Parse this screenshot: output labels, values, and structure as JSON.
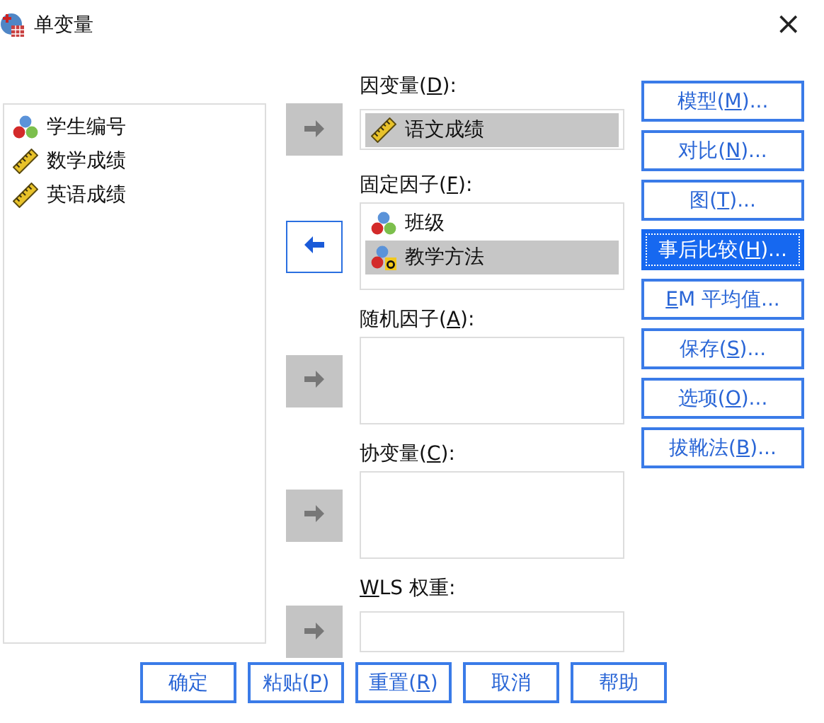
{
  "window": {
    "title": "单变量",
    "close": "×"
  },
  "variables": [
    {
      "name": "学生编号",
      "kind": "nominal"
    },
    {
      "name": "数学成绩",
      "kind": "scale"
    },
    {
      "name": "英语成绩",
      "kind": "scale"
    }
  ],
  "targets": [
    {
      "label": {
        "before": "因变量(",
        "key": "D",
        "after": "):"
      },
      "kind": "single",
      "arrow_disabled": true,
      "items": [
        {
          "name": "语文成绩",
          "kind": "scale",
          "selected": true
        }
      ]
    },
    {
      "label": {
        "before": "固定因子(",
        "key": "F",
        "after": "):"
      },
      "kind": "list",
      "arrow_disabled": false,
      "items": [
        {
          "name": "班级",
          "kind": "nominal",
          "selected": false
        },
        {
          "name": "教学方法",
          "kind": "nominal-string",
          "selected": true
        }
      ]
    },
    {
      "label": {
        "before": "随机因子(",
        "key": "A",
        "after": "):"
      },
      "kind": "list",
      "arrow_disabled": true
    },
    {
      "label": {
        "before": "协变量(",
        "key": "C",
        "after": "):"
      },
      "kind": "list",
      "arrow_disabled": true
    },
    {
      "label": {
        "key": "W",
        "after": "LS 权重:"
      },
      "kind": "single",
      "arrow_disabled": true
    }
  ],
  "side_buttons": [
    {
      "label": {
        "before": "模型(",
        "key": "M",
        "after": ")..."
      },
      "selected": false
    },
    {
      "label": {
        "before": "对比(",
        "key": "N",
        "after": ")..."
      },
      "selected": false
    },
    {
      "label": {
        "before": "图(",
        "key": "T",
        "after": ")..."
      },
      "selected": false
    },
    {
      "label": {
        "before": "事后比较(",
        "key": "H",
        "after": ")..."
      },
      "selected": true
    },
    {
      "label": {
        "key": "E",
        "after": "M 平均值..."
      },
      "selected": false
    },
    {
      "label": {
        "before": "保存(",
        "key": "S",
        "after": ")..."
      },
      "selected": false
    },
    {
      "label": {
        "before": "选项(",
        "key": "O",
        "after": ")..."
      },
      "selected": false
    },
    {
      "label": {
        "before": "拔靴法(",
        "key": "B",
        "after": ")..."
      },
      "selected": false
    }
  ],
  "bottom_buttons": [
    {
      "label": {
        "before": "确定"
      }
    },
    {
      "label": {
        "before": "粘贴(",
        "key": "P",
        "after": ")"
      }
    },
    {
      "label": {
        "before": "重置(",
        "key": "R",
        "after": ")"
      }
    },
    {
      "label": {
        "before": "取消"
      }
    },
    {
      "label": {
        "before": "帮助"
      }
    }
  ]
}
